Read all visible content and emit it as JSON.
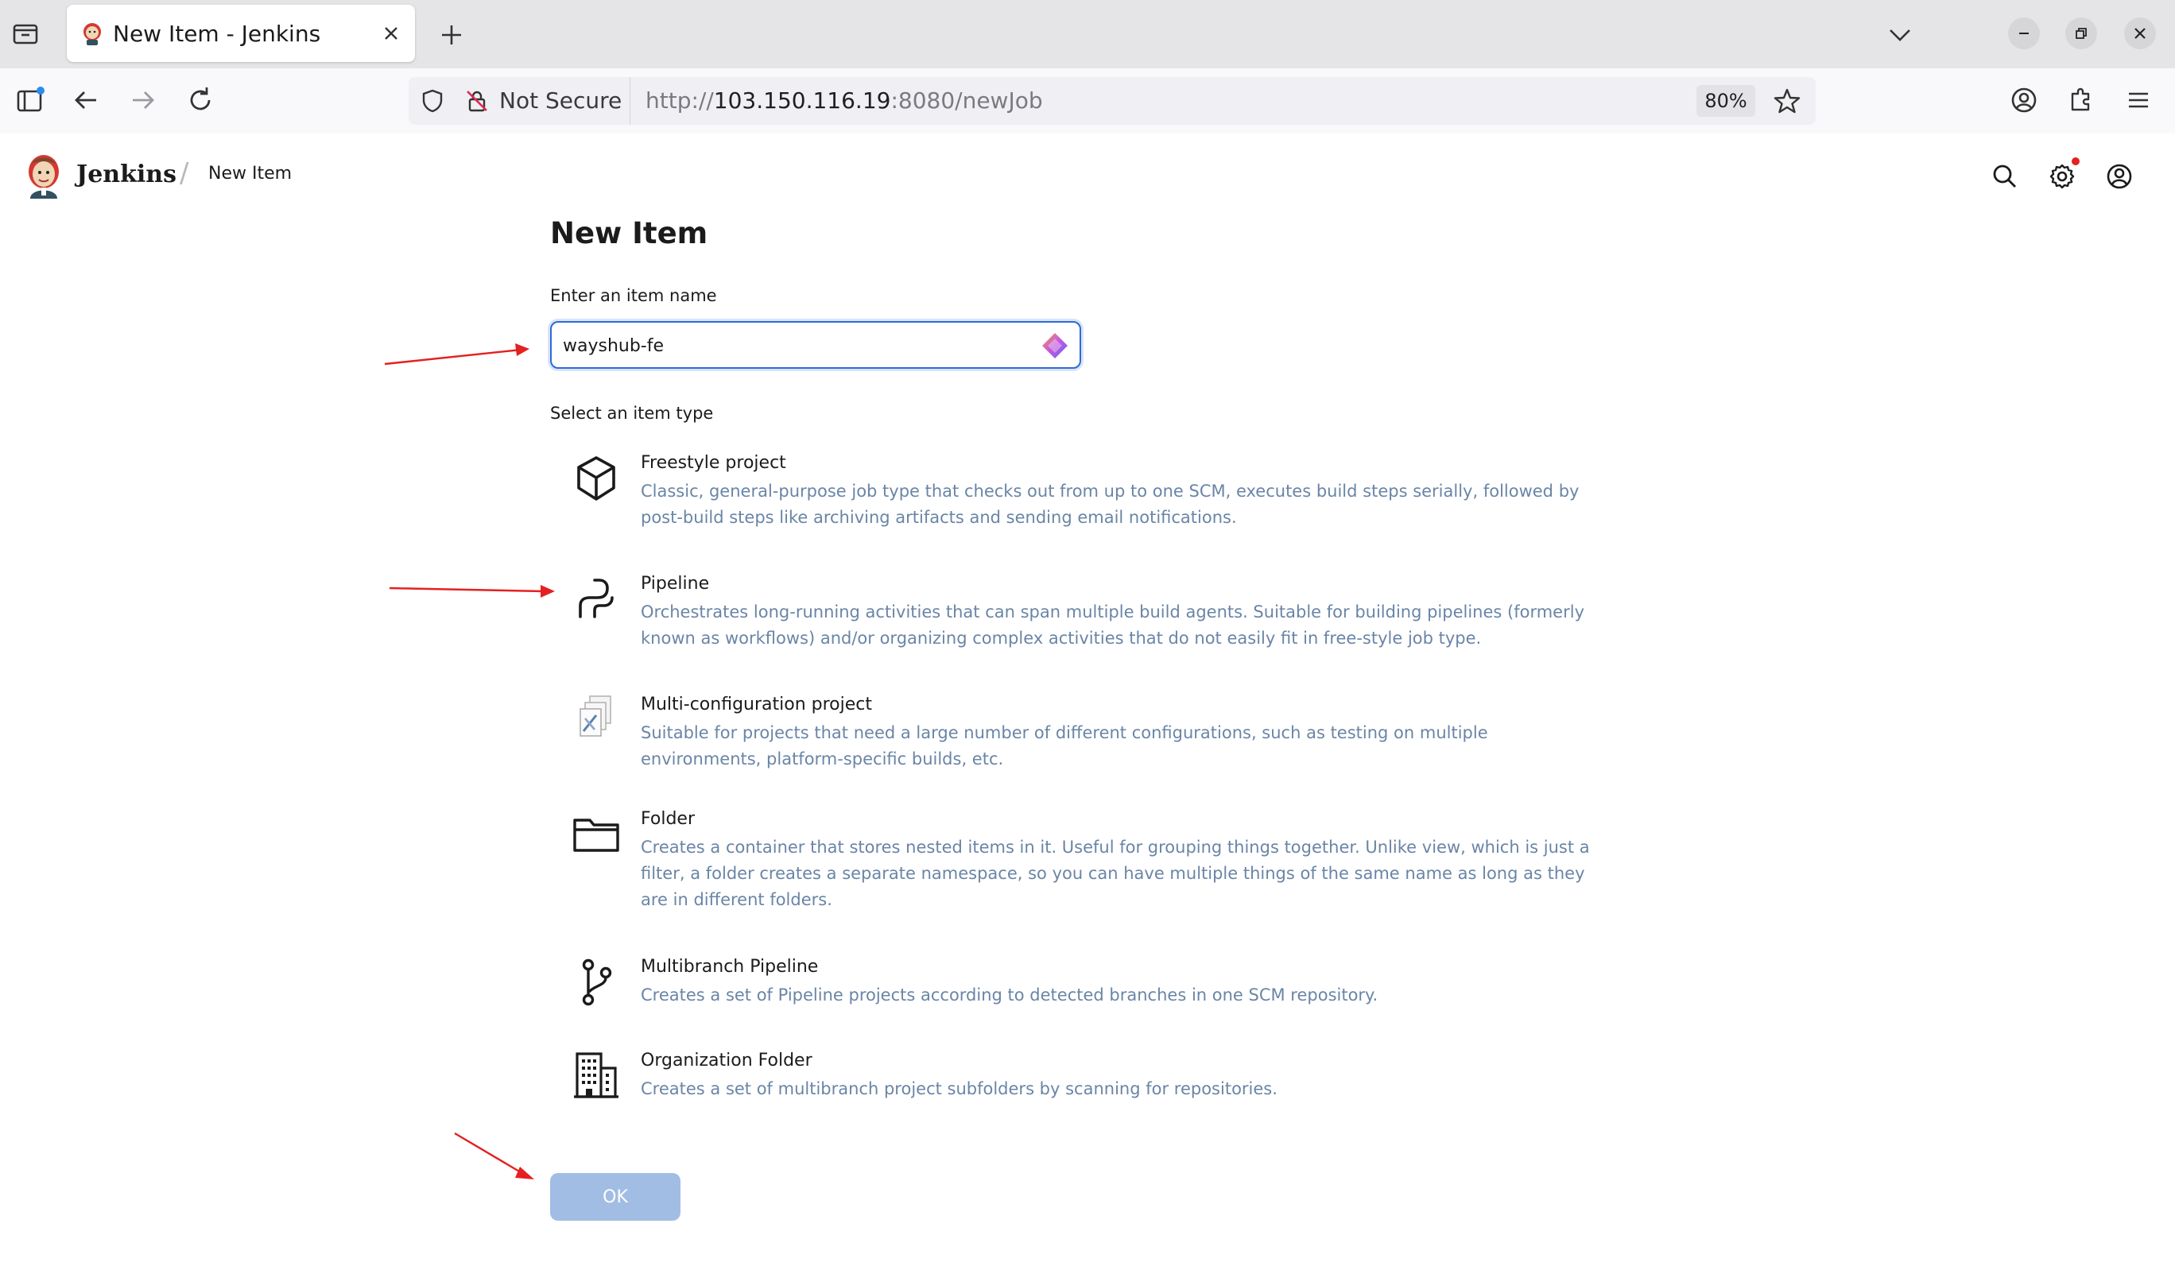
{
  "browser": {
    "tab_title": "New Item - Jenkins",
    "security_label": "Not Secure",
    "url_scheme": "http://",
    "url_host": "103.150.116.19",
    "url_rest": ":8080/newJob",
    "zoom": "80%"
  },
  "header": {
    "brand": "Jenkins",
    "breadcrumb": "New Item"
  },
  "page": {
    "title": "New Item",
    "name_label": "Enter an item name",
    "name_value": "wayshub-fe",
    "type_label": "Select an item type",
    "ok_label": "OK"
  },
  "item_types": [
    {
      "name": "Freestyle project",
      "icon": "cube-icon",
      "description": "Classic, general-purpose job type that checks out from up to one SCM, executes build steps serially, followed by post-build steps like archiving artifacts and sending email notifications."
    },
    {
      "name": "Pipeline",
      "icon": "pipeline-icon",
      "description": "Orchestrates long-running activities that can span multiple build agents. Suitable for building pipelines (formerly known as workflows) and/or organizing complex activities that do not easily fit in free-style job type."
    },
    {
      "name": "Multi-configuration project",
      "icon": "multi-config-icon",
      "description": "Suitable for projects that need a large number of different configurations, such as testing on multiple environments, platform-specific builds, etc."
    },
    {
      "name": "Folder",
      "icon": "folder-icon",
      "description": "Creates a container that stores nested items in it. Useful for grouping things together. Unlike view, which is just a filter, a folder creates a separate namespace, so you can have multiple things of the same name as long as they are in different folders."
    },
    {
      "name": "Multibranch Pipeline",
      "icon": "branch-icon",
      "description": "Creates a set of Pipeline projects according to detected branches in one SCM repository."
    },
    {
      "name": "Organization Folder",
      "icon": "building-icon",
      "description": "Creates a set of multibranch project subfolders by scanning for repositories."
    }
  ],
  "colors": {
    "accent_blue": "#2e6bd6",
    "description_text": "#6a85a6",
    "ok_button_disabled": "#a2bde3",
    "annotation_arrow": "#e52020"
  }
}
